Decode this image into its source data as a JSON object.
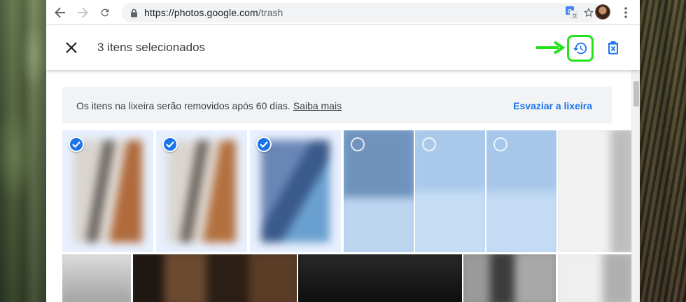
{
  "browser": {
    "url_host": "https://photos.google.com",
    "url_path": "/trash"
  },
  "selection_bar": {
    "title": "3 itens selecionados"
  },
  "banner": {
    "message": "Os itens na lixeira serão removidos após 60 dias.",
    "learn_more": "Saiba mais",
    "empty_trash": "Esvaziar a lixeira"
  },
  "icons": {
    "back": "arrow-left-icon",
    "forward": "arrow-right-icon",
    "reload": "reload-icon",
    "lock": "lock-icon",
    "bookmark": "star-icon",
    "translate": "google-translate-icon",
    "menu": "more-vert-icon",
    "close": "close-icon",
    "restore": "restore-history-icon",
    "delete": "delete-forever-icon"
  },
  "colors": {
    "accent": "#1a73e8",
    "highlight_border": "#22e31a",
    "selected_tile": "#e8f0fe"
  }
}
